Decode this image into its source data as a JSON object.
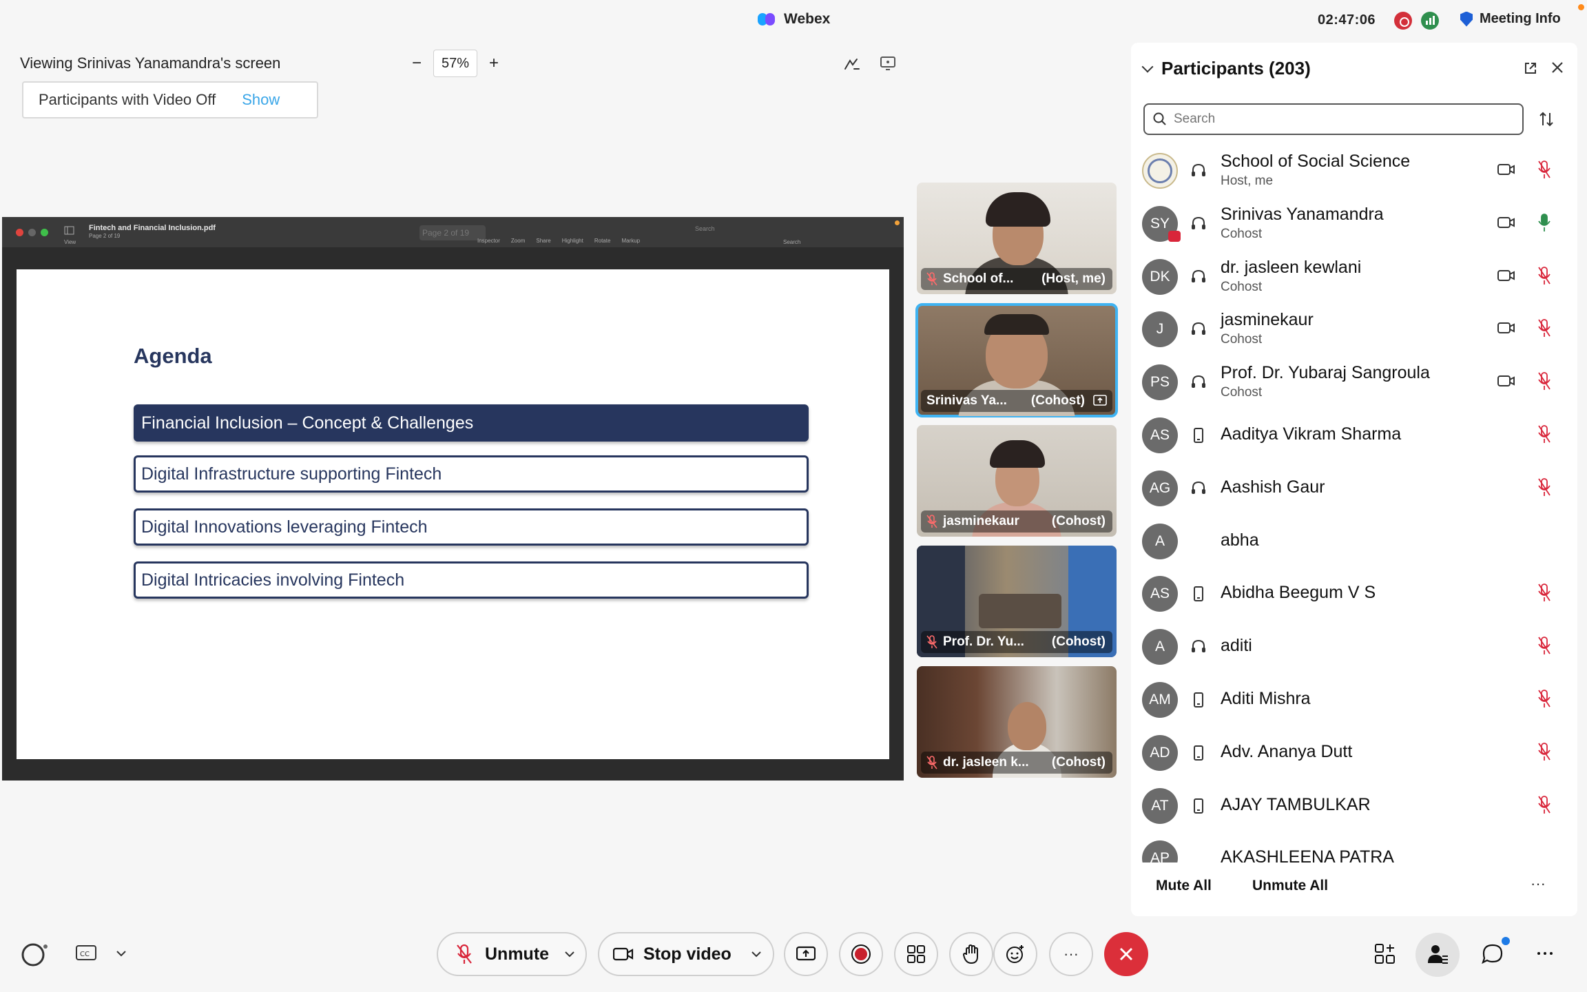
{
  "app": {
    "title": "Webex",
    "clock": "02:47:06",
    "meeting_info": "Meeting Info"
  },
  "viewing": {
    "label": "Viewing Srinivas Yanamandra's screen",
    "zoom": "57%",
    "zoom_out": "−",
    "zoom_in": "+"
  },
  "video_off": {
    "label": "Participants with Video Off",
    "action": "Show"
  },
  "pdf": {
    "file": "Fintech and Financial Inclusion.pdf",
    "page_sub": "Page 2 of 19",
    "page_box": "Page 2 of 19",
    "view": "View",
    "tools": [
      "Inspector",
      "Zoom",
      "Share",
      "Highlight",
      "Rotate",
      "Markup"
    ],
    "search_placeholder": "Search",
    "search_label": "Search"
  },
  "slide": {
    "title": "Agenda",
    "items": [
      "Financial Inclusion – Concept & Challenges",
      "Digital Infrastructure supporting Fintech",
      "Digital Innovations leveraging Fintech",
      "Digital Intricacies involving Fintech"
    ]
  },
  "tiles": [
    {
      "name": "School of...",
      "role": "(Host, me)"
    },
    {
      "name": "Srinivas Ya...",
      "role": "(Cohost)"
    },
    {
      "name": "jasminekaur",
      "role": "(Cohost)"
    },
    {
      "name": "Prof. Dr. Yu...",
      "role": "(Cohost)"
    },
    {
      "name": "dr. jasleen k...",
      "role": "(Cohost)"
    }
  ],
  "panel": {
    "title": "Participants (203)",
    "search_placeholder": "Search",
    "participants": [
      {
        "initials": "",
        "name": "School of Social Science",
        "role": "Host, me",
        "device": "headset",
        "video": true,
        "mic": "muted"
      },
      {
        "initials": "SY",
        "name": "Srinivas Yanamandra",
        "role": "Cohost",
        "device": "headset",
        "video": true,
        "mic": "active"
      },
      {
        "initials": "DK",
        "name": "dr. jasleen kewlani",
        "role": "Cohost",
        "device": "headset",
        "video": true,
        "mic": "muted"
      },
      {
        "initials": "J",
        "name": "jasminekaur",
        "role": "Cohost",
        "device": "headset",
        "video": true,
        "mic": "muted"
      },
      {
        "initials": "PS",
        "name": "Prof. Dr. Yubaraj Sangroula",
        "role": "Cohost",
        "device": "headset",
        "video": true,
        "mic": "muted"
      },
      {
        "initials": "AS",
        "name": "Aaditya Vikram Sharma",
        "role": "",
        "device": "phone",
        "video": false,
        "mic": "muted"
      },
      {
        "initials": "AG",
        "name": "Aashish Gaur",
        "role": "",
        "device": "headset",
        "video": false,
        "mic": "muted"
      },
      {
        "initials": "A",
        "name": "abha",
        "role": "",
        "device": "",
        "video": false,
        "mic": ""
      },
      {
        "initials": "AS",
        "name": "Abidha Beegum V S",
        "role": "",
        "device": "phone",
        "video": false,
        "mic": "muted"
      },
      {
        "initials": "A",
        "name": "aditi",
        "role": "",
        "device": "headset",
        "video": false,
        "mic": "muted"
      },
      {
        "initials": "AM",
        "name": "Aditi Mishra",
        "role": "",
        "device": "phone",
        "video": false,
        "mic": "muted"
      },
      {
        "initials": "AD",
        "name": "Adv. Ananya Dutt",
        "role": "",
        "device": "phone",
        "video": false,
        "mic": "muted"
      },
      {
        "initials": "AT",
        "name": "AJAY TAMBULKAR",
        "role": "",
        "device": "phone",
        "video": false,
        "mic": "muted"
      },
      {
        "initials": "AP",
        "name": "AKASHLEENA PATRA",
        "role": "",
        "device": "",
        "video": false,
        "mic": ""
      }
    ],
    "mute_all": "Mute All",
    "unmute_all": "Unmute All",
    "more": "···"
  },
  "controls": {
    "unmute": "Unmute",
    "stop_video": "Stop video",
    "more": "···"
  },
  "colors": {
    "accent": "#3fb3f2",
    "end": "#db2f3a",
    "slide_navy": "#27365e",
    "muted_red": "#d9253a",
    "mic_green": "#2f8f4e"
  }
}
